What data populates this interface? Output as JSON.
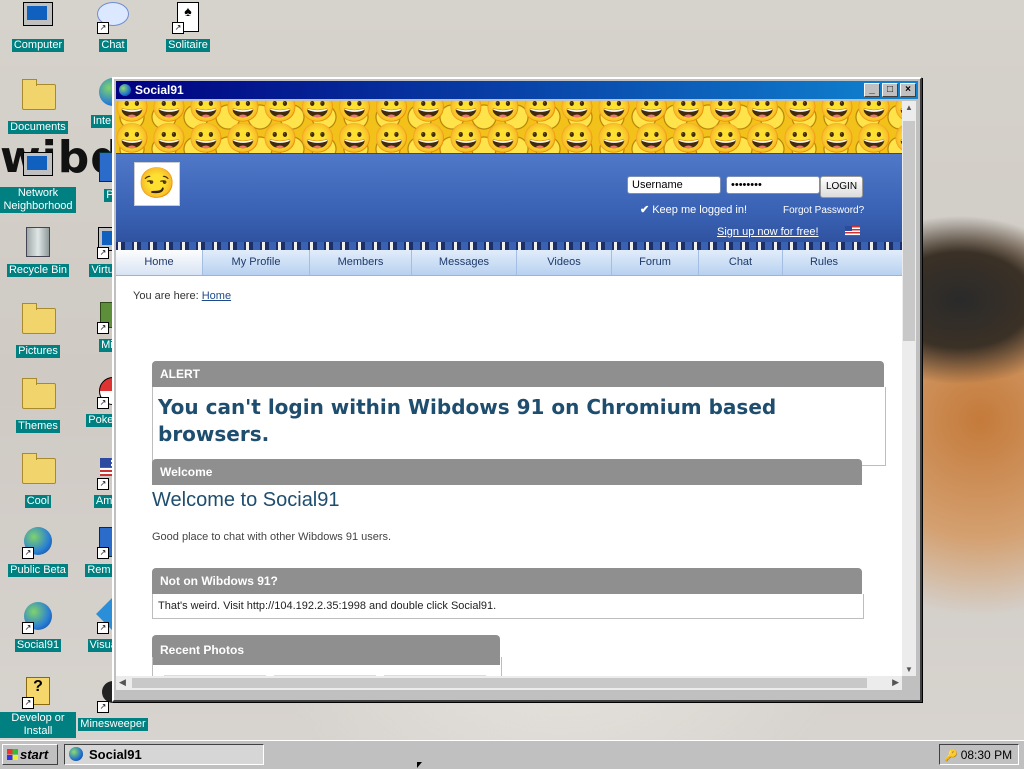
{
  "desktop": {
    "wordmark": "ibdo",
    "icons": [
      {
        "label": "Computer",
        "icon": "computer-icon"
      },
      {
        "label": "Chat",
        "icon": "chat-bubble-icon"
      },
      {
        "label": "Solitaire",
        "icon": "solitaire-icon"
      },
      {
        "label": "Documents",
        "icon": "documents-folder-icon"
      },
      {
        "label": "Inte Exp",
        "icon": "internet-explorer-icon"
      },
      {
        "label": "Network Neighborhood",
        "icon": "network-icon"
      },
      {
        "label": "Pa",
        "icon": "paint-icon"
      },
      {
        "label": "Recycle Bin",
        "icon": "recycle-bin-icon"
      },
      {
        "label": "Virtual M",
        "icon": "virtual-machine-icon"
      },
      {
        "label": "Pictures",
        "icon": "folder-icon"
      },
      {
        "label": "Mine",
        "icon": "minecraft-icon"
      },
      {
        "label": "Themes",
        "icon": "folder-icon"
      },
      {
        "label": "Poke Plati",
        "icon": "pokemon-icon"
      },
      {
        "label": "Cool",
        "icon": "folder-icon"
      },
      {
        "label": "Americ",
        "icon": "flag-icon"
      },
      {
        "label": "Public Beta",
        "icon": "public-beta-icon"
      },
      {
        "label": "Rem Desk",
        "icon": "remote-desktop-icon"
      },
      {
        "label": "Social91",
        "icon": "globe-icon"
      },
      {
        "label": "Visual Co",
        "icon": "visual-code-icon"
      },
      {
        "label": "Develop or Install",
        "icon": "develop-install-icon"
      },
      {
        "label": "Minesweeper",
        "icon": "minesweeper-icon"
      }
    ]
  },
  "window": {
    "title": "Social91",
    "minimize": "_",
    "maximize": "□",
    "close": "×"
  },
  "site": {
    "username_placeholder": "Username",
    "password_value": "••••••••",
    "login_label": "LOGIN",
    "keep_logged": "Keep me logged in!",
    "forgot": "Forgot Password?",
    "signup": "Sign up now for free!",
    "nav": [
      "Home",
      "My Profile",
      "Members",
      "Messages",
      "Videos",
      "Forum",
      "Chat",
      "Rules"
    ],
    "crumbs_prefix": "You are here:",
    "crumbs_link": "Home",
    "alert_head": "ALERT",
    "alert_msg": "You can't login within Wibdows 91 on Chromium based browsers.",
    "welcome_head": "Welcome",
    "welcome_title": "Welcome to Social91",
    "welcome_text": "Good place to chat with other Wibdows 91 users.",
    "not_on_head": "Not on Wibdows 91?",
    "not_on_text": "That's weird. Visit http://104.192.2.35:1998 and double click Social91.",
    "photos_head": "Recent Photos"
  },
  "taskbar": {
    "start": "start",
    "task": "Social91",
    "clock": "08:30 PM"
  }
}
